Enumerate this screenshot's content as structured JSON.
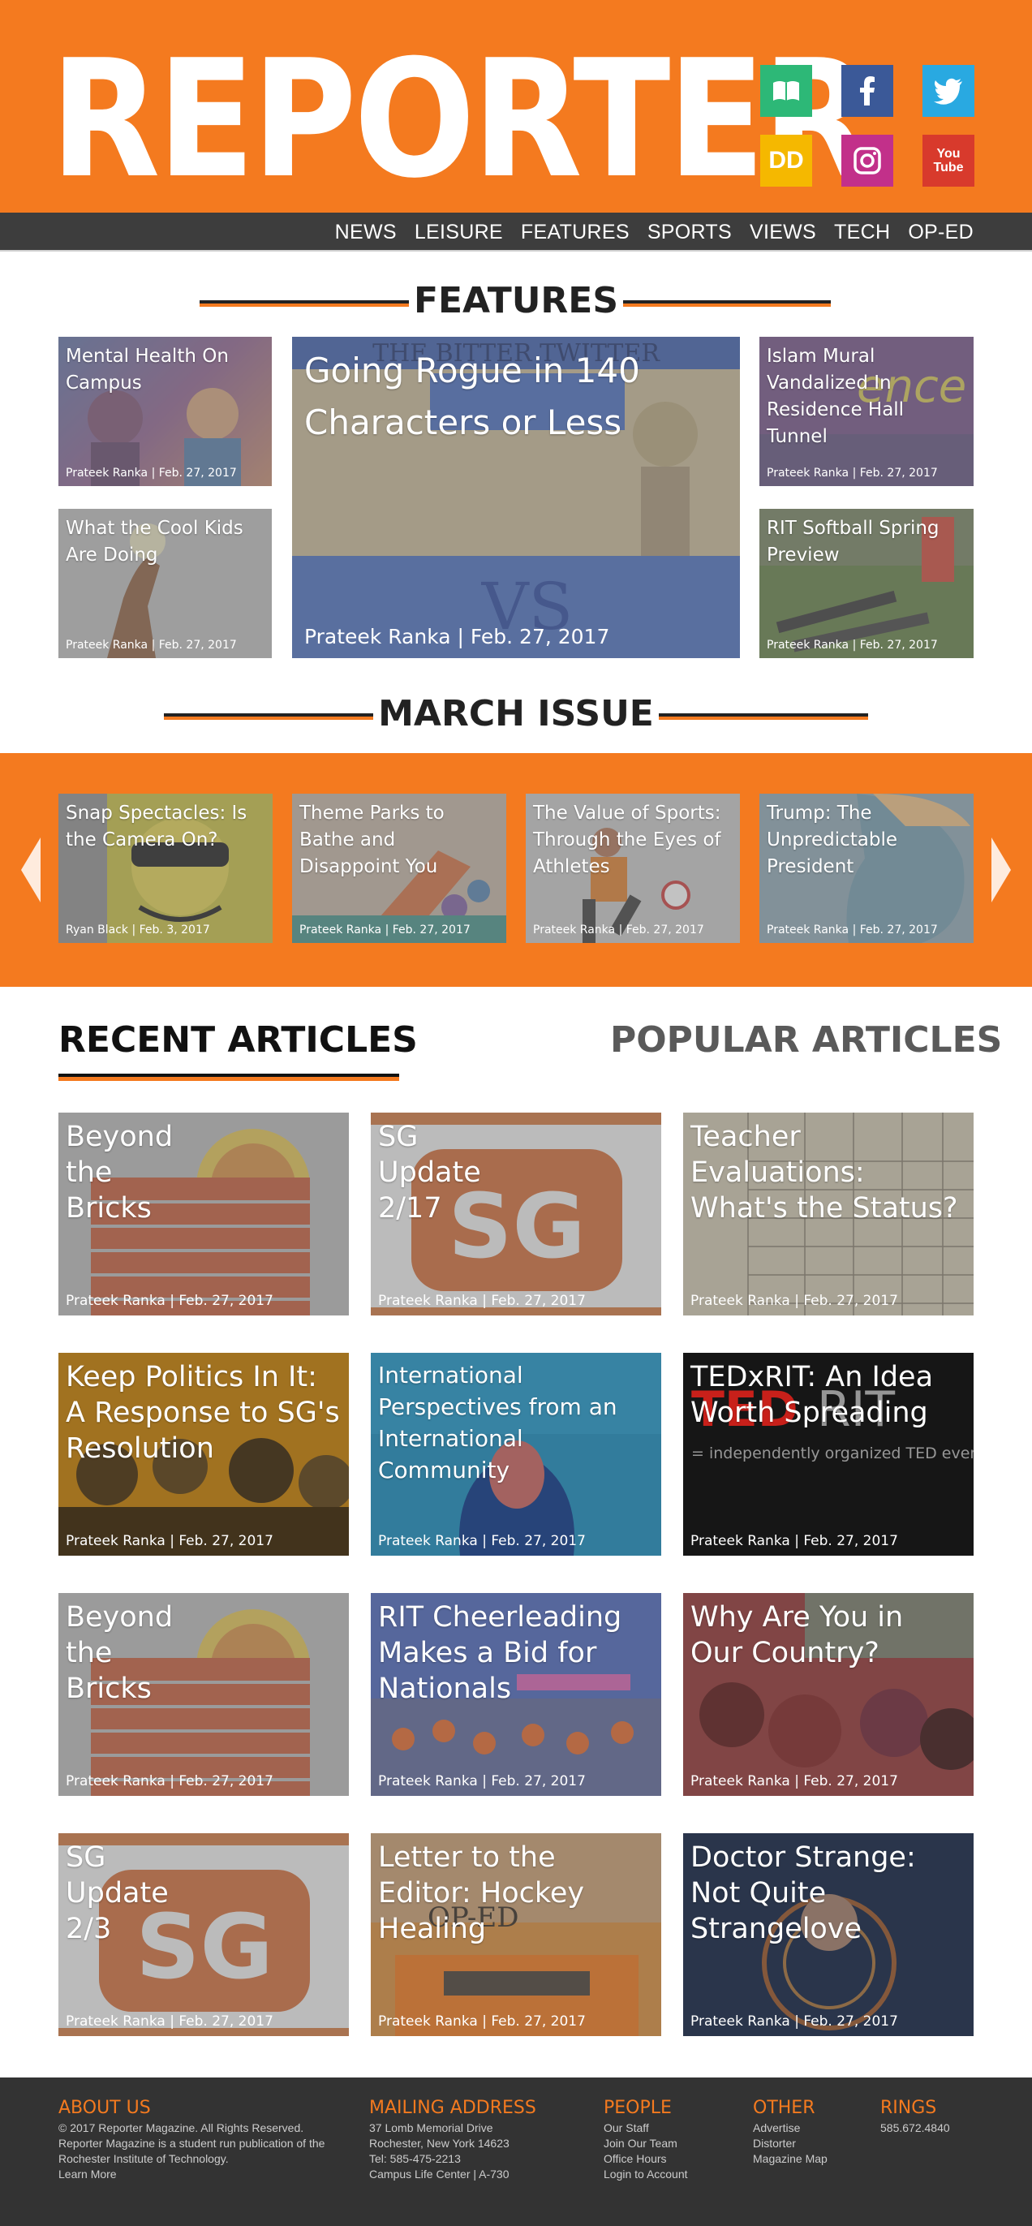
{
  "header": {
    "logo": "REPORTER",
    "social": [
      {
        "name": "book-icon",
        "color": "#2db877"
      },
      {
        "name": "facebook-icon",
        "color": "#3b5998"
      },
      {
        "name": "twitter-icon",
        "color": "#29a9e1"
      },
      {
        "name": "dd-icon",
        "label": "DD",
        "color": "#f5b800"
      },
      {
        "name": "instagram-icon",
        "color": "#c2308a"
      },
      {
        "name": "youtube-icon",
        "label": "You Tube",
        "color": "#d83a2c"
      }
    ]
  },
  "nav": [
    "NEWS",
    "LEISURE",
    "FEATURES",
    "SPORTS",
    "VIEWS",
    "TECH",
    "OP-ED"
  ],
  "features": {
    "title": "FEATURES",
    "cards": [
      {
        "title": "Mental Health On Campus",
        "meta": "Prateek Ranka | Feb. 27, 2017"
      },
      {
        "title": "What the Cool Kids Are Doing",
        "meta": "Prateek Ranka | Feb. 27, 2017"
      },
      {
        "title": "Going Rogue in 140 Characters or Less",
        "meta": "Prateek Ranka | Feb. 27, 2017"
      },
      {
        "title": "Islam Mural Vandalized In Residence Hall Tunnel",
        "meta": "Prateek Ranka | Feb. 27, 2017"
      },
      {
        "title": "RIT Softball Spring Preview",
        "meta": "Prateek Ranka | Feb. 27, 2017"
      }
    ]
  },
  "march": {
    "title": "MARCH ISSUE",
    "cards": [
      {
        "title": "Snap Spectacles: Is the Camera On?",
        "meta": "Ryan Black | Feb. 3, 2017"
      },
      {
        "title": "Theme Parks to Bathe and Disappoint You",
        "meta": "Prateek Ranka | Feb. 27, 2017"
      },
      {
        "title": "The Value of Sports: Through the Eyes of Athletes",
        "meta": "Prateek Ranka | Feb. 27, 2017"
      },
      {
        "title": "Trump: The Unpredictable President",
        "meta": "Prateek Ranka | Feb. 27, 2017"
      }
    ]
  },
  "tabs": {
    "recent": "RECENT ARTICLES",
    "popular": "POPULAR ARTICLES"
  },
  "recent": [
    {
      "title": "Beyond the Bricks",
      "meta": "Prateek Ranka | Feb. 27, 2017"
    },
    {
      "title": "SG Update 2/17",
      "meta": "Prateek Ranka | Feb. 27, 2017"
    },
    {
      "title": "Teacher Evaluations: What's the Status?",
      "meta": "Prateek Ranka | Feb. 27, 2017"
    },
    {
      "title": "Keep Politics In It: A Response to SG's Resolution",
      "meta": "Prateek Ranka | Feb. 27, 2017"
    },
    {
      "title": "International Perspectives from an International Community",
      "meta": "Prateek Ranka | Feb. 27, 2017"
    },
    {
      "title": "TEDxRIT: An Idea Worth Spreading",
      "meta": "Prateek Ranka | Feb. 27, 2017"
    },
    {
      "title": "Beyond the Bricks",
      "meta": "Prateek Ranka | Feb. 27, 2017"
    },
    {
      "title": "RIT Cheerleading Makes a Bid for Nationals",
      "meta": "Prateek Ranka | Feb. 27, 2017"
    },
    {
      "title": "Why Are You in Our Country?",
      "meta": "Prateek Ranka | Feb. 27, 2017"
    },
    {
      "title": "SG Update 2/3",
      "meta": "Prateek Ranka | Feb. 27, 2017"
    },
    {
      "title": "Letter to the Editor: Hockey Healing",
      "meta": "Prateek Ranka | Feb. 27, 2017"
    },
    {
      "title": "Doctor Strange: Not Quite Strangelove",
      "meta": "Prateek Ranka | Feb. 27, 2017"
    }
  ],
  "footer": {
    "about": {
      "head": "ABOUT US",
      "lines": [
        "© 2017 Reporter Magazine. All Rights Reserved.",
        "Reporter Magazine is a student run publication of the",
        "Rochester Institute of Technology.",
        "Learn More"
      ]
    },
    "mailing": {
      "head": "MAILING ADDRESS",
      "lines": [
        "37 Lomb Memorial Drive",
        "Rochester, New York 14623",
        "Tel: 585-475-2213",
        "Campus Life Center | A-730"
      ]
    },
    "people": {
      "head": "PEOPLE",
      "lines": [
        "Our Staff",
        "Join Our Team",
        "Office Hours",
        "Login to Account"
      ]
    },
    "other": {
      "head": "OTHER",
      "lines": [
        "Advertise",
        "Distorter",
        "Magazine Map"
      ]
    },
    "rings": {
      "head": "RINGS",
      "lines": [
        "585.672.4840"
      ]
    }
  },
  "colors": {
    "accent": "#f47a1f",
    "nav": "#3d3d3d",
    "footer": "#333333"
  }
}
